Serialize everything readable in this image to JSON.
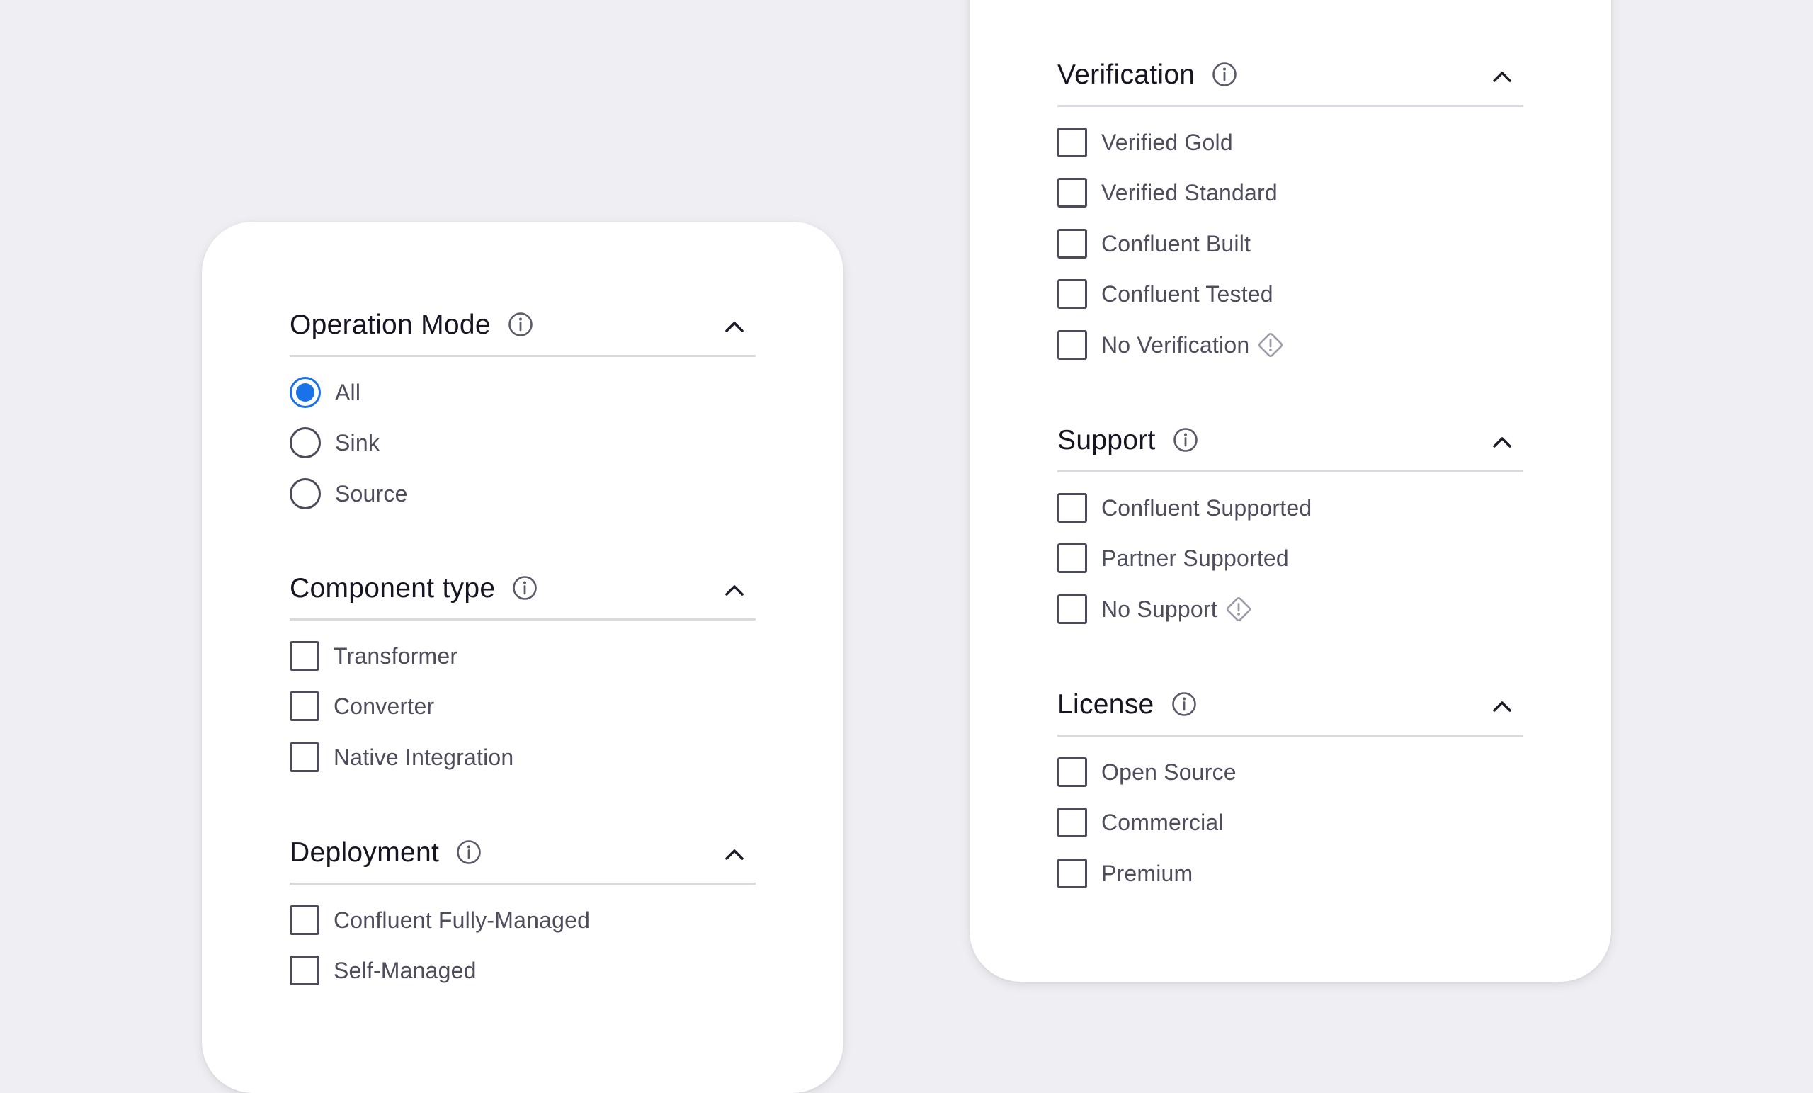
{
  "left_panel": {
    "sections": [
      {
        "title": "Operation Mode",
        "control": "radio",
        "options": [
          {
            "label": "All",
            "checked": true
          },
          {
            "label": "Sink",
            "checked": false
          },
          {
            "label": "Source",
            "checked": false
          }
        ]
      },
      {
        "title": "Component type",
        "control": "checkbox",
        "options": [
          {
            "label": "Transformer",
            "checked": false
          },
          {
            "label": "Converter",
            "checked": false
          },
          {
            "label": "Native Integration",
            "checked": false
          }
        ]
      },
      {
        "title": "Deployment",
        "control": "checkbox",
        "options": [
          {
            "label": "Confluent Fully-Managed",
            "checked": false
          },
          {
            "label": "Self-Managed",
            "checked": false
          }
        ]
      }
    ]
  },
  "right_panel": {
    "sections": [
      {
        "title": "Verification",
        "control": "checkbox",
        "options": [
          {
            "label": "Verified Gold",
            "checked": false
          },
          {
            "label": "Verified Standard",
            "checked": false
          },
          {
            "label": "Confluent Built",
            "checked": false
          },
          {
            "label": "Confluent Tested",
            "checked": false
          },
          {
            "label": "No Verification",
            "checked": false,
            "icon": "warning-diamond-icon"
          }
        ]
      },
      {
        "title": "Support",
        "control": "checkbox",
        "options": [
          {
            "label": "Confluent Supported",
            "checked": false
          },
          {
            "label": "Partner Supported",
            "checked": false
          },
          {
            "label": "No Support",
            "checked": false,
            "icon": "warning-diamond-icon"
          }
        ]
      },
      {
        "title": "License",
        "control": "checkbox",
        "options": [
          {
            "label": "Open Source",
            "checked": false
          },
          {
            "label": "Commercial",
            "checked": false
          },
          {
            "label": "Premium",
            "checked": false
          }
        ]
      }
    ]
  },
  "colors": {
    "background": "#efeff3",
    "panel": "#ffffff",
    "accent": "#1a72e8",
    "heading_text": "#161622",
    "option_text": "#4d4d5c",
    "control_border": "#4b4b59",
    "divider": "#d9d9e0",
    "warning_icon": "#9a9aa8"
  }
}
